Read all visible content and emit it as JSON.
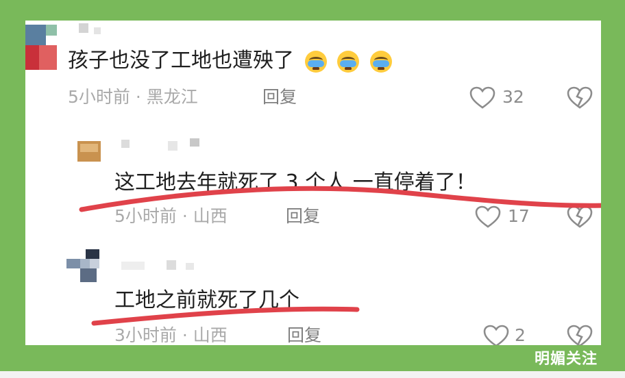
{
  "comments": [
    {
      "content": "孩子也没了工地也遭殃了",
      "emoji": "loudly-crying-face",
      "time_location": "5小时前 · 黑龙江",
      "reply_label": "回复",
      "likes": "32"
    },
    {
      "content": "这工地去年就死了 3 个人 一直停着了！",
      "time_location": "5小时前 · 山西",
      "reply_label": "回复",
      "likes": "17"
    },
    {
      "content": "工地之前就死了几个",
      "time_location": "3小时前 · 山西",
      "reply_label": "回复",
      "likes": "2"
    }
  ],
  "watermark": "明媚关注",
  "colors": {
    "frame_background": "#79b95a",
    "highlight_underline": "#e0424a"
  },
  "icons": [
    "heart-icon",
    "broken-heart-icon"
  ]
}
